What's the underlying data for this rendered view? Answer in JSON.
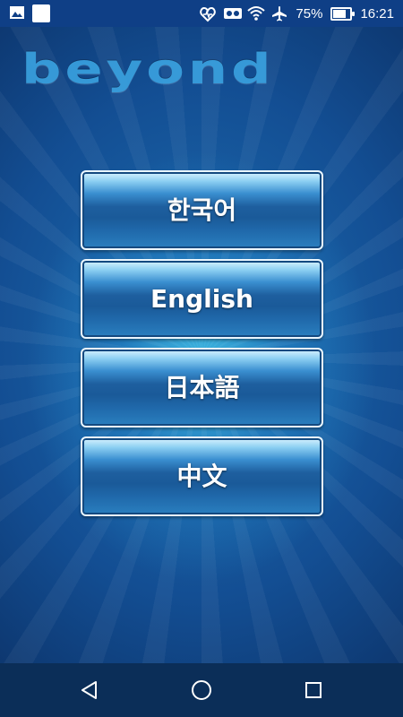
{
  "status_bar": {
    "left_icons": [
      "gallery-icon",
      "notification-square-icon"
    ],
    "right_icons": [
      "heartbeat-icon",
      "vr-icon",
      "wifi-icon",
      "airplane-icon",
      "battery-icon"
    ],
    "battery_percent": "75%",
    "battery_level": 0.75,
    "time": "16:21"
  },
  "app": {
    "logo_text": "beyond",
    "languages": [
      {
        "id": "korean",
        "label": "한국어"
      },
      {
        "id": "english",
        "label": "English"
      },
      {
        "id": "japanese",
        "label": "日本語"
      },
      {
        "id": "chinese",
        "label": "中文"
      }
    ]
  },
  "nav_bar": {
    "icons": [
      "back-icon",
      "home-icon",
      "recents-icon"
    ]
  },
  "colors": {
    "status_bar": "#0f3f86",
    "nav_bar": "#0b2e58",
    "logo": "#3aa2e0",
    "button_text": "#ffffff"
  }
}
